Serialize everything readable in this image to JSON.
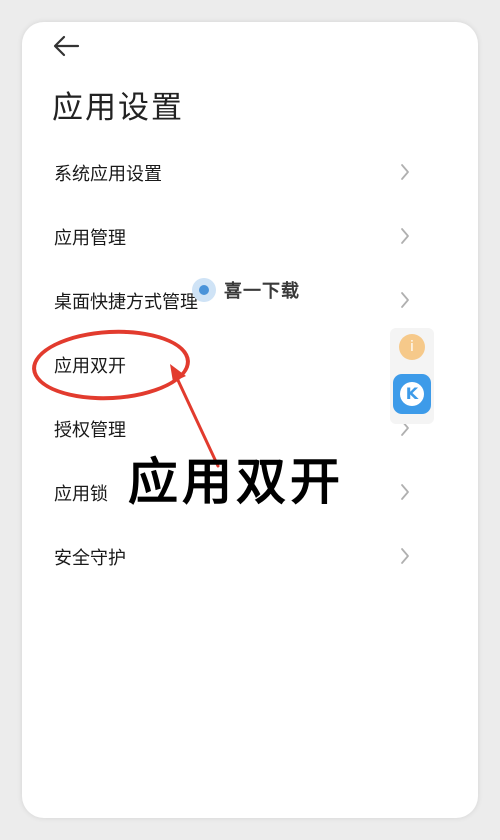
{
  "header": {
    "back_icon": "arrow-left-icon",
    "title": "应用设置"
  },
  "menu": {
    "items": [
      {
        "label": "系统应用设置"
      },
      {
        "label": "应用管理"
      },
      {
        "label": "桌面快捷方式管理"
      },
      {
        "label": "应用双开"
      },
      {
        "label": "授权管理"
      },
      {
        "label": "应用锁"
      },
      {
        "label": "安全守护"
      }
    ],
    "chevron_icon": "chevron-right-icon"
  },
  "watermark": {
    "text": "喜一下载",
    "logo_icon": "site-logo-icon"
  },
  "floating_widget": {
    "top_icon": "info-icon",
    "app_icon": "k-app-icon",
    "app_letter": "K"
  },
  "annotation": {
    "caption": "应用双开",
    "color": "#e23b2e"
  }
}
